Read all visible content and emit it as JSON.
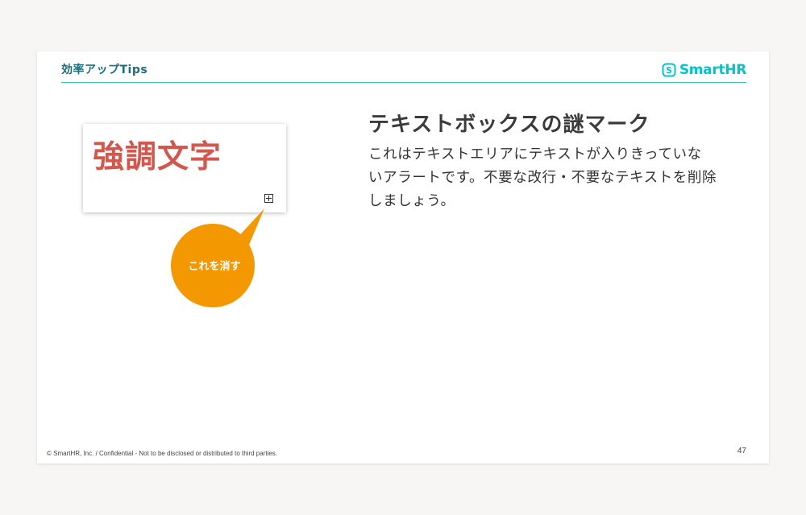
{
  "header": {
    "section_title": "効率アップTips",
    "logo_text": "SmartHR"
  },
  "demo": {
    "sample_text": "強調文字",
    "overflow_mark_icon": "boxed-plus-icon",
    "callout_label": "これを消す"
  },
  "content": {
    "headline": "テキストボックスの謎マーク",
    "body_lines": [
      "これはテキストエリアにテキストが入りきっていな",
      "いアラートです。不要な改行・不要なテキストを削除",
      "しましょう。"
    ]
  },
  "footer": {
    "copyright": "© SmartHR, Inc. / Confidential - Not to be disclosed or distributed to third parties.",
    "page_number": "47"
  },
  "colors": {
    "accent_teal": "#3cc3c9",
    "logo_cyan": "#00c4cc",
    "emphasis_red": "#d4574e",
    "callout_orange": "#f39800"
  }
}
